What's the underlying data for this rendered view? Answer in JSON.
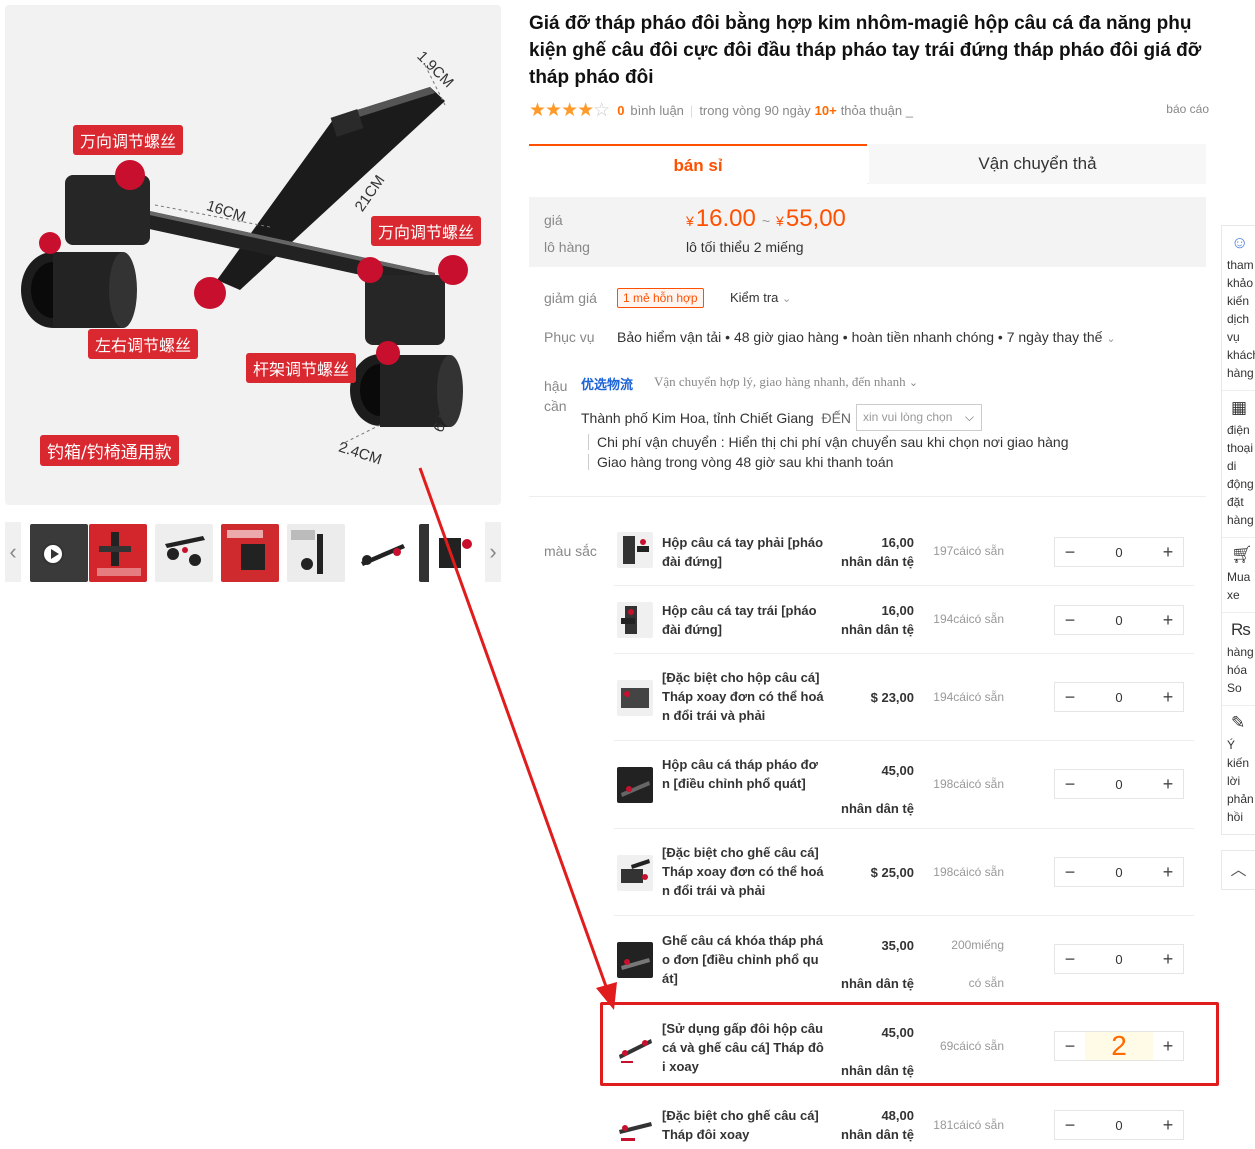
{
  "product": {
    "title": "Giá đỡ tháp pháo đôi bằng hợp kim nhôm-magiê hộp câu cá đa năng phụ kiện ghế câu đôi cực đôi đầu tháp pháo tay trái đứng tháp pháo đôi giá đỡ tháp pháo đôi",
    "rating_stars": 4,
    "reviews_count": "0",
    "reviews_label": "bình luận",
    "period_label": "trong vòng 90 ngày",
    "deals_count": "10+",
    "deals_label": "thỏa thuận _",
    "report": "báo cáo"
  },
  "image": {
    "labels": [
      "万向调节螺丝",
      "万向调节螺丝",
      "左右调节螺丝",
      "杆架调节螺丝",
      "钓箱/钓椅通用款"
    ],
    "dims": [
      "1.9CM",
      "21CM",
      "16CM",
      "6.5CM",
      "2.4CM"
    ]
  },
  "tabs": [
    "bán sỉ",
    "Vận chuyển thả"
  ],
  "pricing": {
    "price_label": "giá",
    "batch_label": "lô hàng",
    "currency": "¥",
    "price_low": "16.00",
    "tilde": "~",
    "price_high": "55,00",
    "min_batch": "lô tối thiểu 2 miếng"
  },
  "discount": {
    "label": "giảm giá",
    "badge": "1 mẻ hỗn hợp",
    "check": "Kiểm tra"
  },
  "service": {
    "label": "Phục vụ",
    "text": "Bảo hiểm vận tải • 48 giờ giao hàng • hoàn tiền nhanh chóng • 7 ngày thay thế"
  },
  "logistics": {
    "label": "hậu cần",
    "badge": "优选物流",
    "desc": "Vận chuyển hợp lý, giao hàng nhanh, đến nhanh",
    "origin": "Thành phố Kim Hoa, tỉnh Chiết Giang",
    "to": "ĐẾN",
    "dest_placeholder": "xin vui lòng chọn",
    "cost_note": "Chi phí vận chuyển : Hiển thị chi phí vận chuyển sau khi chọn nơi giao hàng",
    "delivery_note": "Giao hàng trong vòng 48 giờ sau khi thanh toán"
  },
  "sku": {
    "label": "màu sắc",
    "rows": [
      {
        "name": "Hộp câu cá tay phải [pháo đài đứng]",
        "price": "16,00",
        "unit": "nhân dân tệ",
        "stock": "197cáicó sẵn",
        "qty": "0"
      },
      {
        "name": "Hộp câu cá tay trái [pháo đài đứng]",
        "price": "16,00",
        "unit": "nhân dân tệ",
        "stock": "194cáicó sẵn",
        "qty": "0"
      },
      {
        "name": "[Đặc biệt cho hộp câu cá] Tháp xoay đơn có thể hoán đổi trái và phải",
        "price": "$ 23,00",
        "unit": "",
        "stock": "194cáicó sẵn",
        "qty": "0"
      },
      {
        "name": "Hộp câu cá tháp pháo đơn [điều chỉnh phổ quát]",
        "price": "45,00",
        "unit": "nhân dân tệ",
        "stock": "198cáicó sẵn",
        "qty": "0"
      },
      {
        "name": "[Đặc biệt cho ghế câu cá] Tháp xoay đơn có thể hoán đổi trái và phải",
        "price": "$ 25,00",
        "unit": "",
        "stock": "198cáicó sẵn",
        "qty": "0"
      },
      {
        "name": "Ghế câu cá khóa tháp pháo đơn [điều chỉnh phổ quát]",
        "price": "35,00",
        "unit": "nhân dân tệ",
        "stock": "200miếng",
        "stock2": "có sẵn",
        "qty": "0"
      },
      {
        "name": "[Sử dụng gấp đôi hộp câu cá và ghế câu cá] Tháp đôi xoay",
        "price": "45,00",
        "unit": "nhân dân tệ",
        "stock": "69cáicó sẵn",
        "qty": "2"
      },
      {
        "name": "[Đặc biệt cho ghế câu cá] Tháp đôi xoay",
        "price": "48,00",
        "unit": "nhân dân tệ",
        "stock": "181cáicó sẵn",
        "qty": "0"
      }
    ]
  },
  "rail": {
    "items": [
      {
        "icon": "smiley-icon",
        "label": "tham khảo kiến dịch vụ khách hàng"
      },
      {
        "icon": "qr-code-icon",
        "label": "điện thoại di động đặt hàng"
      },
      {
        "icon": "cart-icon",
        "label": "Mua xe"
      },
      {
        "icon": "compare-icon",
        "label": "hàng hóa So"
      },
      {
        "icon": "edit-icon",
        "label": "Ý kiến lời phản hồi"
      }
    ]
  },
  "colors": {
    "accent": "#ff5000",
    "highlight": "#e01c1c",
    "link": "#1d63d8"
  }
}
